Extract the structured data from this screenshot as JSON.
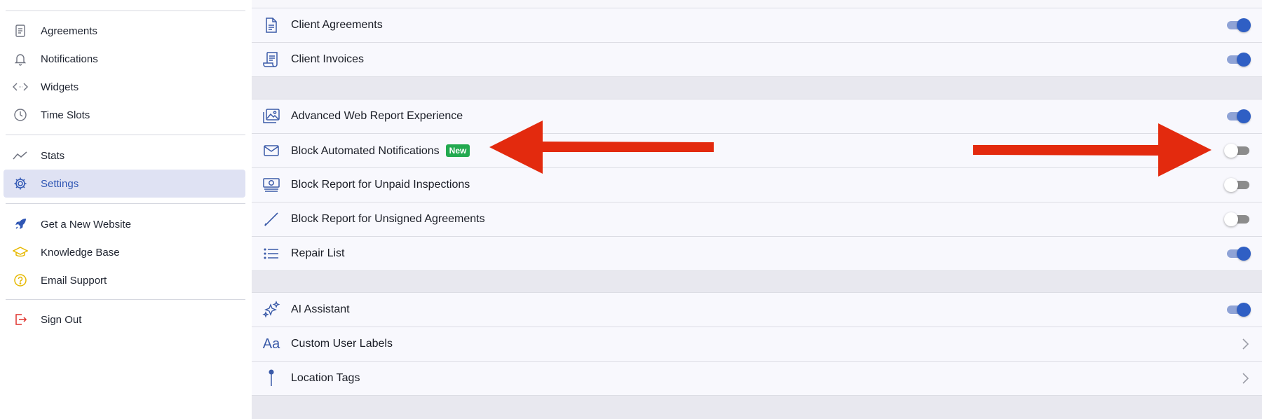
{
  "sidebar": {
    "items": [
      {
        "label": "Agreements",
        "icon": "document-icon"
      },
      {
        "label": "Notifications",
        "icon": "bell-icon"
      },
      {
        "label": "Widgets",
        "icon": "code-icon"
      },
      {
        "label": "Time Slots",
        "icon": "clock-icon"
      },
      {
        "label": "Stats",
        "icon": "trend-line-icon"
      },
      {
        "label": "Settings",
        "icon": "gear-icon",
        "active": true
      },
      {
        "label": "Get a New Website",
        "icon": "rocket-icon"
      },
      {
        "label": "Knowledge Base",
        "icon": "graduation-cap-icon"
      },
      {
        "label": "Email Support",
        "icon": "question-circle-icon"
      },
      {
        "label": "Sign Out",
        "icon": "sign-out-icon"
      }
    ]
  },
  "settings": {
    "rows": [
      {
        "label": "Client Agreements",
        "icon": "document-icon",
        "control": "toggle",
        "on": true
      },
      {
        "label": "Client Invoices",
        "icon": "receipt-icon",
        "control": "toggle",
        "on": true
      },
      {
        "label": "Advanced Web Report Experience",
        "icon": "image-gallery-icon",
        "control": "toggle",
        "on": true
      },
      {
        "label": "Block Automated Notifications",
        "icon": "envelope-icon",
        "control": "toggle",
        "on": false,
        "badge": "New"
      },
      {
        "label": "Block Report for Unpaid Inspections",
        "icon": "money-icon",
        "control": "toggle",
        "on": false
      },
      {
        "label": "Block Report for Unsigned Agreements",
        "icon": "pen-icon",
        "control": "toggle",
        "on": false
      },
      {
        "label": "Repair List",
        "icon": "list-icon",
        "control": "toggle",
        "on": true
      },
      {
        "label": "AI Assistant",
        "icon": "sparkles-icon",
        "control": "toggle",
        "on": true
      },
      {
        "label": "Custom User Labels",
        "icon": "text-aa-icon",
        "control": "chevron",
        "glyph": "Aa"
      },
      {
        "label": "Location Tags",
        "icon": "pin-icon",
        "control": "chevron"
      }
    ]
  },
  "annotations": {
    "arrow_color": "#e32a0e"
  },
  "colors": {
    "accent": "#2f5fc4",
    "badge_green": "#22a94f",
    "warning_yellow": "#e6b800",
    "danger_red": "#e0322d"
  }
}
